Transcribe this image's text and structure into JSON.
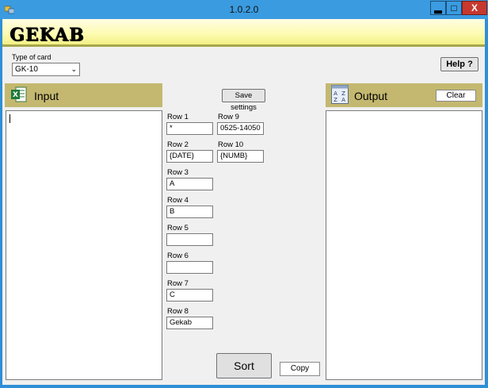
{
  "window": {
    "title": "1.0.2.0",
    "minimize_label": "▂",
    "maximize_label": "□",
    "close_label": "X"
  },
  "banner": {
    "logo_text": "GEKAB"
  },
  "card": {
    "label": "Type of card",
    "selected": "GK-10"
  },
  "help": {
    "label": "Help ?"
  },
  "input_pane": {
    "title": "Input",
    "text": ""
  },
  "output_pane": {
    "title": "Output",
    "clear_label": "Clear",
    "text": ""
  },
  "settings": {
    "save_label": "Save settings"
  },
  "rows": [
    {
      "label": "Row 1",
      "value": "*"
    },
    {
      "label": "Row 2",
      "value": "{DATE}"
    },
    {
      "label": "Row 3",
      "value": "A"
    },
    {
      "label": "Row 4",
      "value": "B"
    },
    {
      "label": "Row 5",
      "value": ""
    },
    {
      "label": "Row 6",
      "value": ""
    },
    {
      "label": "Row 7",
      "value": "C"
    },
    {
      "label": "Row 8",
      "value": "Gekab"
    },
    {
      "label": "Row 9",
      "value": "0525-14050"
    },
    {
      "label": "Row 10",
      "value": "{NUMB}"
    }
  ],
  "actions": {
    "sort_label": "Sort",
    "copy_label": "Copy"
  },
  "icons": {
    "app": "app-icon",
    "excel": "excel-icon",
    "sort_az": "sort-az-icon",
    "dropdown": "chevron-down-icon"
  }
}
